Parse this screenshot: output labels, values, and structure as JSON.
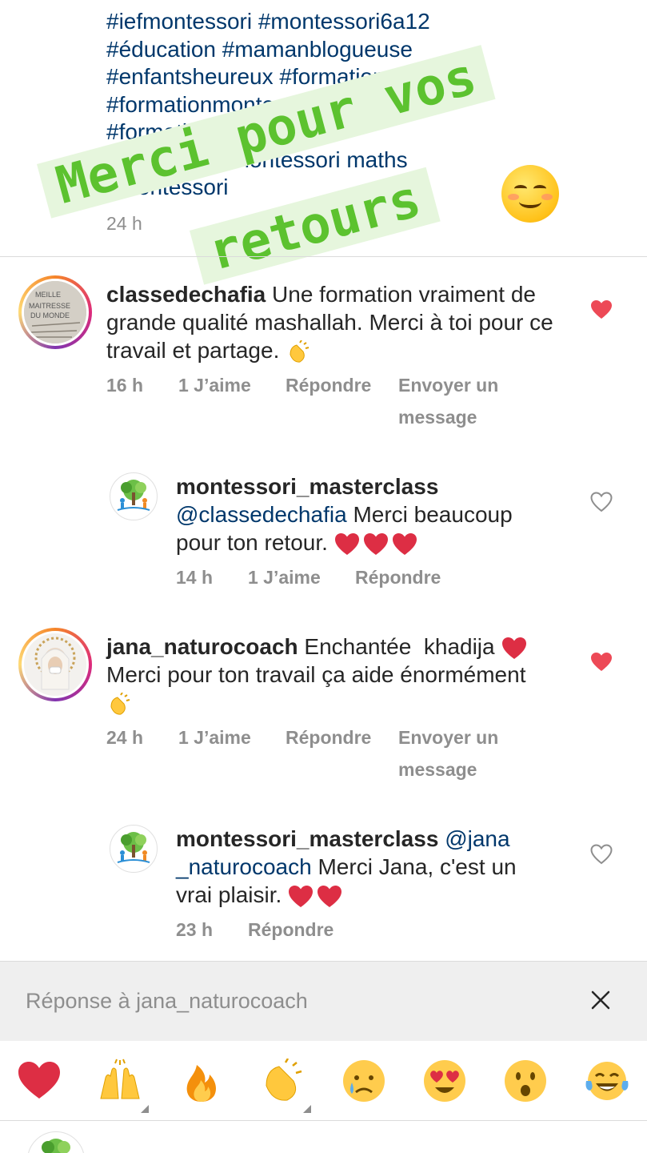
{
  "caption": {
    "lines": [
      "#iefmontessori #montessori6a12",
      "#éducation #mamanblogueuse",
      "#enfantsheureux #formation",
      "#formationmontessori",
      "#formation",
      "#                  montessori maths",
      "#montessori"
    ],
    "time": "24 h"
  },
  "sticker": {
    "line1": "Merci pour vos",
    "line2": "retours",
    "emoji": "smiling-face-icon"
  },
  "comments": [
    {
      "user": "classedechafia",
      "text": "Une formation vraiment de grande qualité mashallah. Merci à toi pour ce travail et partage.",
      "time": "16 h",
      "likes": "1 J’aime",
      "reply": "Répondre",
      "message_1": "Envoyer un",
      "message_2": "message",
      "liked": true
    },
    {
      "user": "montessori_masterclass",
      "mention": "@classedechafia",
      "text": "Merci beaucoup pour ton retour.",
      "time": "14 h",
      "likes": "1 J’aime",
      "reply": "Répondre",
      "liked": false
    },
    {
      "user": "jana_naturocoach",
      "text_1": "Enchantée  khadija",
      "text_2": "Merci pour ton travail ça aide énormément",
      "time": "24 h",
      "likes": "1 J’aime",
      "reply": "Répondre",
      "message_1": "Envoyer un",
      "message_2": "message",
      "liked": true
    },
    {
      "user": "montessori_masterclass",
      "mention_1": "@jana",
      "mention_2": "_naturocoach",
      "text": "Merci Jana, c'est un vrai plaisir.",
      "time": "23 h",
      "reply": "Répondre",
      "liked": false
    }
  ],
  "reply_bar": {
    "text": "Réponse à jana_naturocoach",
    "close_icon": "close-icon"
  },
  "emoji_bar": [
    "red-heart-icon",
    "raising-hands-icon",
    "fire-icon",
    "clapping-hands-icon",
    "crying-face-icon",
    "heart-eyes-face-icon",
    "surprised-face-icon",
    "tears-of-joy-face-icon"
  ],
  "colors": {
    "link": "#00376b",
    "like_red": "#ed4956",
    "meta_gray": "#8e8e8e",
    "sticker_green": "#5cc22f",
    "sticker_bg": "#e6f6dd"
  }
}
